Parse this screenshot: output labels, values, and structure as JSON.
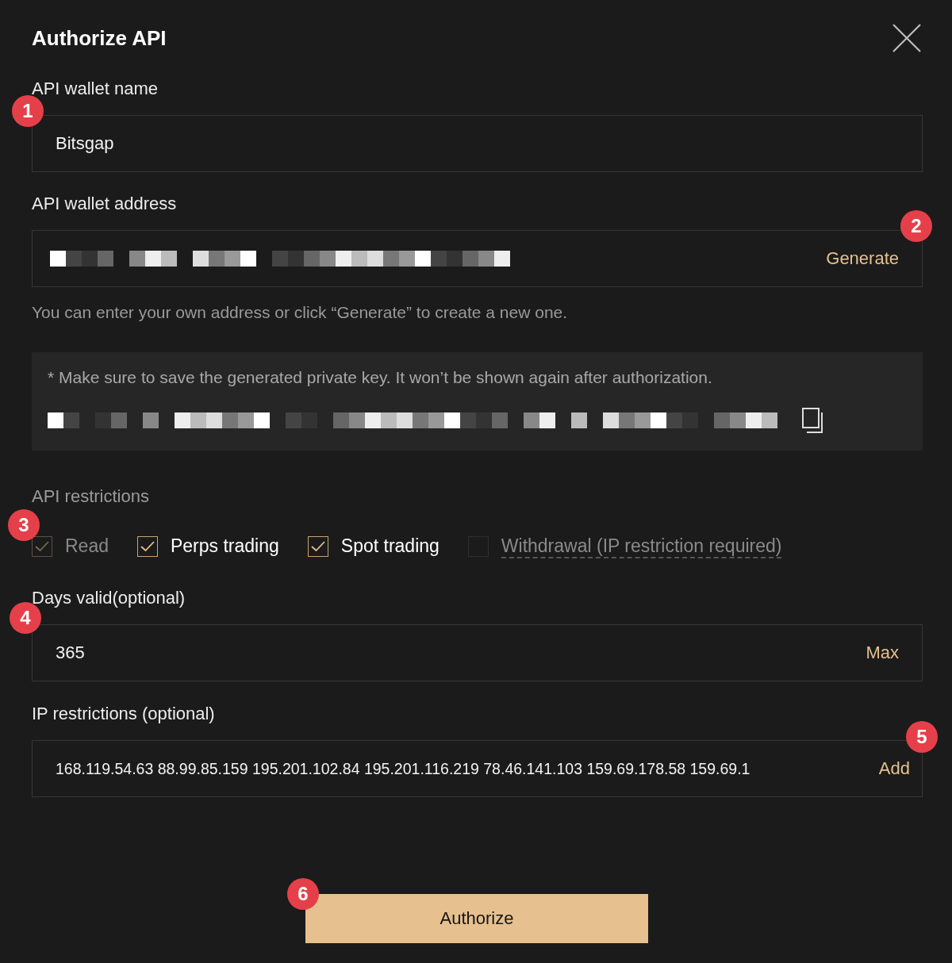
{
  "dialog": {
    "title": "Authorize API"
  },
  "fields": [
    {
      "label": "API wallet name",
      "value": "Bitsgap",
      "annotation": "1"
    },
    {
      "label": "API wallet address",
      "action": "Generate",
      "annotation": "2",
      "helper": "You can enter your own address or click “Generate” to create a new one."
    }
  ],
  "private_key": {
    "notice": "* Make sure to save the generated private key. It won’t be shown again after authorization."
  },
  "restrictions": {
    "label": "API restrictions",
    "annotation": "3",
    "options": [
      {
        "label": "Read",
        "checked": true,
        "disabled": true,
        "has_tooltip": false
      },
      {
        "label": "Perps trading",
        "checked": true,
        "disabled": false,
        "has_tooltip": false
      },
      {
        "label": "Spot trading",
        "checked": true,
        "disabled": false,
        "has_tooltip": false
      },
      {
        "label": "Withdrawal (IP restriction required)",
        "checked": false,
        "disabled": true,
        "has_tooltip": true
      }
    ]
  },
  "days": {
    "label": "Days valid(optional)",
    "value": "365",
    "action": "Max",
    "annotation": "4"
  },
  "ip": {
    "label": "IP restrictions (optional)",
    "value": "168.119.54.63 88.99.85.159 195.201.102.84 195.201.116.219 78.46.141.103 159.69.178.58 159.69.1",
    "action": "Add",
    "annotation": "5"
  },
  "submit": {
    "label": "Authorize",
    "annotation": "6"
  }
}
